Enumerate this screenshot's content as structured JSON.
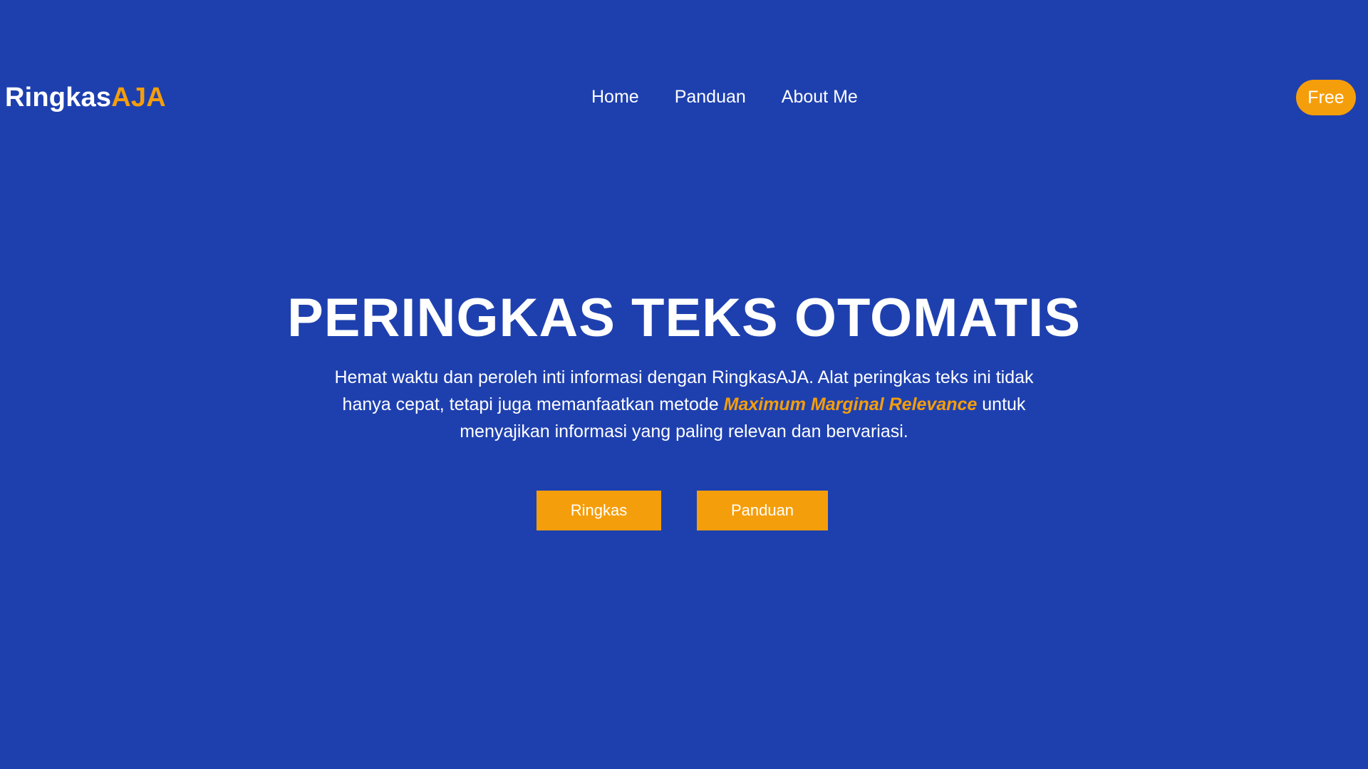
{
  "colors": {
    "background": "#1e40af",
    "accent": "#f59e0b",
    "text": "#ffffff"
  },
  "header": {
    "logo_main": "Ringkas",
    "logo_accent": "AJA",
    "nav": [
      {
        "label": "Home"
      },
      {
        "label": "Panduan"
      },
      {
        "label": "About Me"
      }
    ],
    "free_label": "Free"
  },
  "hero": {
    "title": "PERINGKAS TEKS OTOMATIS",
    "description_before": "Hemat waktu dan peroleh inti informasi dengan RingkasAJA. Alat peringkas teks ini tidak hanya cepat, tetapi juga memanfaatkan metode ",
    "description_highlight": "Maximum Marginal Relevance",
    "description_after": " untuk menyajikan informasi yang paling relevan dan bervariasi.",
    "buttons": [
      {
        "label": "Ringkas"
      },
      {
        "label": "Panduan"
      }
    ]
  }
}
